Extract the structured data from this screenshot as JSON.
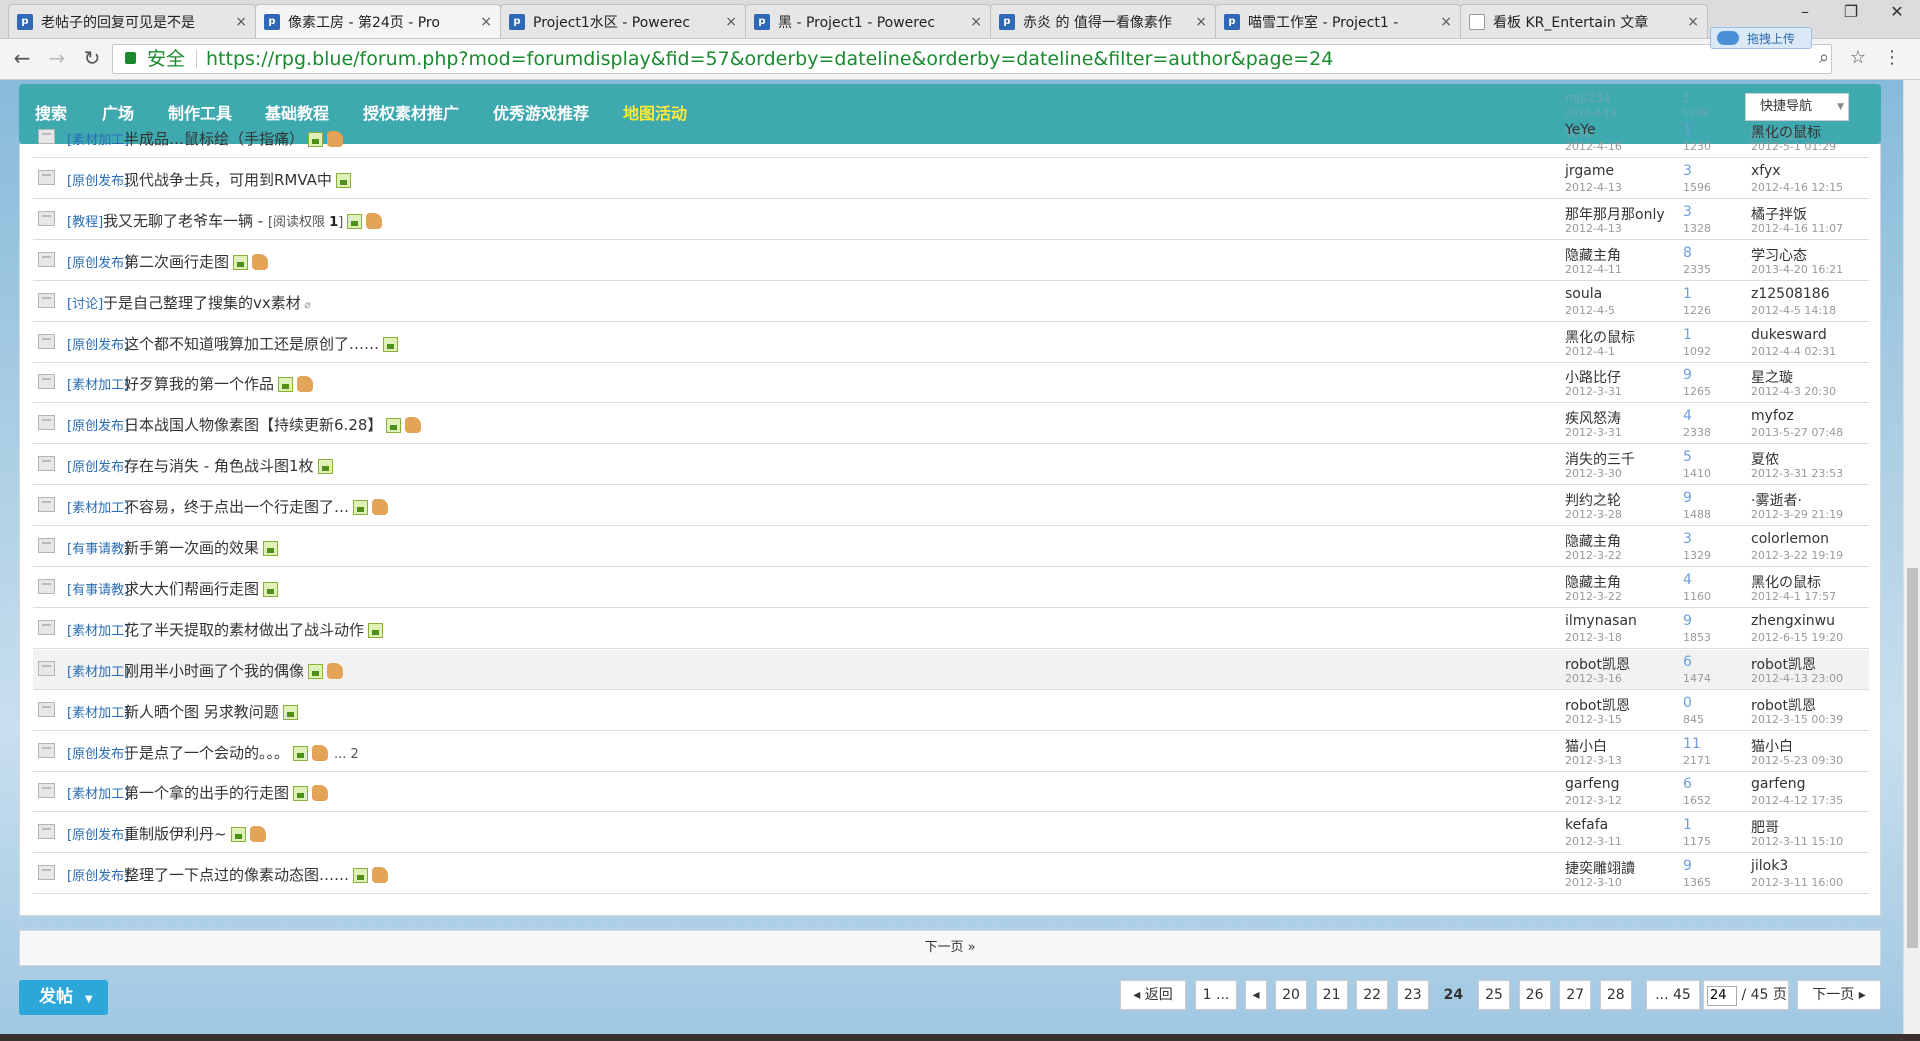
{
  "browser": {
    "tabs": [
      {
        "title": "老帖子的回复可见是不是",
        "icon": "rpg-favicon"
      },
      {
        "title": "像素工房 - 第24页 - Pro",
        "icon": "rpg-favicon"
      },
      {
        "title": "Project1水区 - Powerec",
        "icon": "rpg-favicon"
      },
      {
        "title": "黑 - Project1 - Powerec",
        "icon": "rpg-favicon"
      },
      {
        "title": "赤炎 的 值得一看像素作",
        "icon": "rpg-favicon"
      },
      {
        "title": "喵雪工作室 - Project1 -",
        "icon": "rpg-favicon"
      },
      {
        "title": "看板 KR_Entertain 文章",
        "icon": "doc-icon"
      }
    ],
    "tab_close": "×",
    "secure_label": "安全",
    "url": "https://rpg.blue/forum.php?mod=forumdisplay&fid=57&orderby=dateline&orderby=dateline&filter=author&page=24",
    "upload_label": "拖拽上传"
  },
  "forumnav": {
    "items": [
      "搜索",
      "广场",
      "制作工具",
      "基础教程",
      "授权素材推广",
      "优秀游戏推荐",
      "地图活动"
    ],
    "quick_nav": "快捷导航",
    "ghost_texts": {
      "author1": "mj0234",
      "date1": "2012-4-16",
      "num1": "1",
      "num2": "1199",
      "author2": "YeYe",
      "last": "黑化の鼠标"
    }
  },
  "threads": [
    {
      "cat": "[素材加工]",
      "subject": "半成品…鼠标绘（手指痛）",
      "img": true,
      "thumb": true,
      "author": "YeYe",
      "adate": "2012-4-16",
      "replies": "1",
      "views": "1230",
      "last": "黑化の鼠标",
      "ldate": "2012-5-1 01:29"
    },
    {
      "cat": "[原创发布]",
      "subject": "现代战争士兵，可用到RMVA中",
      "img": true,
      "thumb": false,
      "author": "jrgame",
      "adate": "2012-4-13",
      "replies": "3",
      "views": "1596",
      "last": "xfyx",
      "ldate": "2012-4-16 12:15"
    },
    {
      "cat": "[教程]",
      "subject": "我又无聊了老爷车一辆 - ",
      "perm": "[阅读权限 ",
      "perm_val": "1",
      "perm_end": "]",
      "img": true,
      "thumb": true,
      "author": "那年那月那only",
      "adate": "2012-4-13",
      "replies": "3",
      "views": "1328",
      "last": "橘子拌饭",
      "ldate": "2012-4-16 11:07"
    },
    {
      "cat": "[原创发布]",
      "subject": "第二次画行走图",
      "img": true,
      "thumb": true,
      "author": "隐藏主角",
      "adate": "2012-4-11",
      "replies": "8",
      "views": "2335",
      "last": "学习心态",
      "ldate": "2013-4-20 16:21"
    },
    {
      "cat": "[讨论]",
      "subject": "于是自己整理了搜集的vx素材",
      "attach": true,
      "img": false,
      "thumb": false,
      "author": "soula",
      "adate": "2012-4-5",
      "replies": "1",
      "views": "1226",
      "last": "z12508186",
      "ldate": "2012-4-5 14:18"
    },
    {
      "cat": "[原创发布]",
      "subject": "这个都不知道哦算加工还是原创了……",
      "img": true,
      "thumb": false,
      "author": "黑化の鼠标",
      "adate": "2012-4-1",
      "replies": "1",
      "views": "1092",
      "last": "dukesward",
      "ldate": "2012-4-4 02:31"
    },
    {
      "cat": "[素材加工]",
      "subject": "好歹算我的第一个作品",
      "img": true,
      "thumb": true,
      "author": "小路比仔",
      "adate": "2012-3-31",
      "replies": "9",
      "views": "1265",
      "last": "星之璇",
      "ldate": "2012-4-3 20:30"
    },
    {
      "cat": "[原创发布]",
      "subject": "日本战国人物像素图【持续更新6.28】",
      "img": true,
      "thumb": true,
      "author": "疾风怒涛",
      "adate": "2012-3-31",
      "replies": "4",
      "views": "2338",
      "last": "myfoz",
      "ldate": "2013-5-27 07:48"
    },
    {
      "cat": "[原创发布]",
      "subject": "存在与消失 - 角色战斗图1枚",
      "img": true,
      "thumb": false,
      "author": "消失的三千",
      "adate": "2012-3-30",
      "replies": "5",
      "views": "1410",
      "last": "夏侬",
      "ldate": "2012-3-31 23:53"
    },
    {
      "cat": "[素材加工]",
      "subject": "不容易，终于点出一个行走图了…",
      "img": true,
      "thumb": true,
      "author": "判约之轮",
      "adate": "2012-3-28",
      "replies": "9",
      "views": "1488",
      "last": "·雾逝者·",
      "ldate": "2012-3-29 21:19"
    },
    {
      "cat": "[有事请教]",
      "subject": "新手第一次画的效果",
      "img": true,
      "thumb": false,
      "author": "隐藏主角",
      "adate": "2012-3-22",
      "replies": "3",
      "views": "1329",
      "last": "colorlemon",
      "ldate": "2012-3-22 19:19"
    },
    {
      "cat": "[有事请教]",
      "subject": "求大大们帮画行走图",
      "img": true,
      "thumb": false,
      "author": "隐藏主角",
      "adate": "2012-3-22",
      "replies": "4",
      "views": "1160",
      "last": "黑化の鼠标",
      "ldate": "2012-4-1 17:57"
    },
    {
      "cat": "[素材加工]",
      "subject": "花了半天提取的素材做出了战斗动作",
      "img": true,
      "thumb": false,
      "author": "ilmynasan",
      "adate": "2012-3-18",
      "replies": "9",
      "views": "1853",
      "last": "zhengxinwu",
      "ldate": "2012-6-15 19:20"
    },
    {
      "cat": "[素材加工]",
      "subject": "刚用半小时画了个我的偶像",
      "img": true,
      "thumb": true,
      "hover": true,
      "author": "robot凯恩",
      "adate": "2012-3-16",
      "replies": "6",
      "views": "1474",
      "last": "robot凯恩",
      "ldate": "2012-4-13 23:00"
    },
    {
      "cat": "[素材加工]",
      "subject": "新人晒个图 另求教问题",
      "img": true,
      "thumb": false,
      "author": "robot凯恩",
      "adate": "2012-3-15",
      "replies": "0",
      "views": "845",
      "last": "robot凯恩",
      "ldate": "2012-3-15 00:39"
    },
    {
      "cat": "[原创发布]",
      "subject": "于是点了一个会动的。。。",
      "img": true,
      "thumb": true,
      "pages": "... 2",
      "author": "猫小白",
      "adate": "2012-3-13",
      "replies": "11",
      "views": "2171",
      "last": "猫小白",
      "ldate": "2012-5-23 09:30"
    },
    {
      "cat": "[素材加工]",
      "subject": "第一个拿的出手的行走图",
      "img": true,
      "thumb": true,
      "author": "garfeng",
      "adate": "2012-3-12",
      "replies": "6",
      "views": "1652",
      "last": "garfeng",
      "ldate": "2012-4-12 17:35"
    },
    {
      "cat": "[原创发布]",
      "subject": "重制版伊利丹~",
      "img": true,
      "thumb": true,
      "author": "kefafa",
      "adate": "2012-3-11",
      "replies": "1",
      "views": "1175",
      "last": "肥哥",
      "ldate": "2012-3-11 15:10"
    },
    {
      "cat": "[原创发布]",
      "subject": "整理了一下点过的像素动态图……",
      "img": true,
      "thumb": true,
      "author": "捷奕雕翊讀",
      "adate": "2012-3-10",
      "replies": "9",
      "views": "1365",
      "last": "jilok3",
      "ldate": "2012-3-11 16:00"
    }
  ],
  "nextpage_label": "下一页 »",
  "post_button": "发帖",
  "pagination": {
    "back": "返回",
    "first": "1 ...",
    "pages": [
      "20",
      "21",
      "22",
      "23",
      "24",
      "25",
      "26",
      "27",
      "28"
    ],
    "current": "24",
    "last": "... 45",
    "input_value": "24",
    "total": "/ 45 页",
    "next": "下一页"
  }
}
